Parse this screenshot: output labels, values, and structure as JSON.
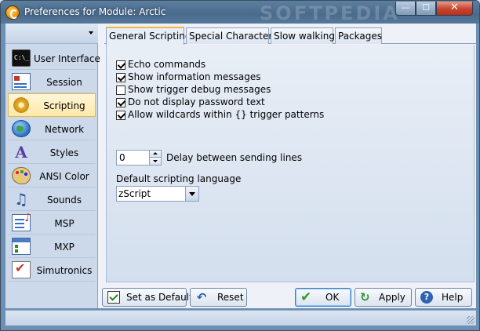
{
  "window": {
    "title": "Preferences for Module: Arctic",
    "watermark": "SOFTPEDIA",
    "minimize_glyph": "—",
    "maximize_glyph": "☐",
    "close_glyph": "✕"
  },
  "sidebar": {
    "items": [
      {
        "label": "User Interface",
        "icon": "terminal-icon",
        "icon_text": "C:\\_"
      },
      {
        "label": "Session",
        "icon": "session-icon"
      },
      {
        "label": "Scripting",
        "icon": "gear-icon",
        "active": true
      },
      {
        "label": "Network",
        "icon": "globe-icon"
      },
      {
        "label": "Styles",
        "icon": "styles-icon",
        "icon_text": "A"
      },
      {
        "label": "ANSI Color",
        "icon": "palette-icon"
      },
      {
        "label": "Sounds",
        "icon": "music-note-icon",
        "icon_text": "♫"
      },
      {
        "label": "MSP",
        "icon": "msp-icon"
      },
      {
        "label": "MXP",
        "icon": "mxp-icon"
      },
      {
        "label": "Simutronics",
        "icon": "checkbox-icon"
      }
    ]
  },
  "tabs": [
    {
      "label": "General Scripting",
      "active": true
    },
    {
      "label": "Special Characters"
    },
    {
      "label": "Slow walking"
    },
    {
      "label": "Packages"
    }
  ],
  "general_scripting": {
    "options": [
      {
        "label": "Echo commands",
        "checked": true
      },
      {
        "label": "Show information messages",
        "checked": true
      },
      {
        "label": "Show trigger debug messages",
        "checked": false
      },
      {
        "label": "Do not display password text",
        "checked": true
      },
      {
        "label": "Allow wildcards within {} trigger patterns",
        "checked": true
      }
    ],
    "delay": {
      "value": "0",
      "label": "Delay between sending lines"
    },
    "language": {
      "label": "Default scripting language",
      "value": "zScript"
    }
  },
  "buttons": {
    "set_default": "Set as Default",
    "reset": "Reset",
    "ok": "OK",
    "apply": "Apply",
    "help": "Help",
    "reset_glyph": "↶",
    "ok_glyph": "✔",
    "apply_glyph": "↻",
    "help_glyph": "?"
  }
}
